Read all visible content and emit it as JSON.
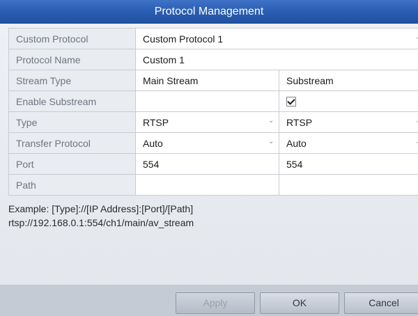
{
  "title": "Protocol Management",
  "rows": {
    "custom_protocol": {
      "label": "Custom Protocol",
      "value": "Custom Protocol 1"
    },
    "protocol_name": {
      "label": "Protocol Name",
      "value": "Custom 1"
    },
    "stream_type": {
      "label": "Stream Type",
      "main": "Main Stream",
      "sub": "Substream"
    },
    "enable_substream": {
      "label": "Enable Substream",
      "checked": true
    },
    "type": {
      "label": "Type",
      "main": "RTSP",
      "sub": "RTSP"
    },
    "transfer_protocol": {
      "label": "Transfer Protocol",
      "main": "Auto",
      "sub": "Auto"
    },
    "port": {
      "label": "Port",
      "main": "554",
      "sub": "554"
    },
    "path": {
      "label": "Path",
      "main": "",
      "sub": ""
    }
  },
  "example": {
    "line1": "Example: [Type]://[IP Address]:[Port]/[Path]",
    "line2": "rtsp://192.168.0.1:554/ch1/main/av_stream"
  },
  "buttons": {
    "apply": "Apply",
    "ok": "OK",
    "cancel": "Cancel"
  },
  "colors": {
    "title_bar": "#2c5fb3",
    "footer": "#c5cbd4"
  }
}
